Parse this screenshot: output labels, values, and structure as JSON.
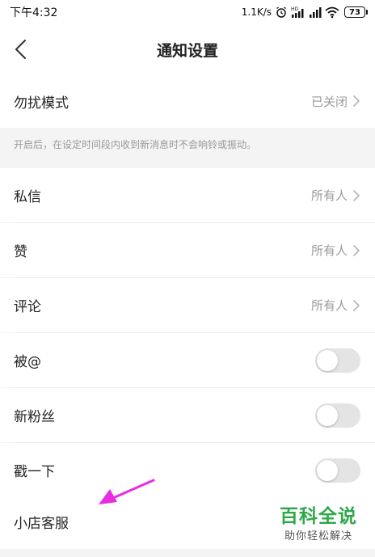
{
  "status_bar": {
    "time": "下午4:32",
    "network_speed": "1.1K/s",
    "battery_level": "73",
    "icons": [
      "alarm-icon",
      "hd-signal-icon",
      "signal-icon",
      "wifi-icon",
      "battery-icon"
    ]
  },
  "header": {
    "title": "通知设置",
    "back_icon": "chevron-left-icon"
  },
  "dnd": {
    "label": "勿扰模式",
    "value": "已关闭",
    "hint": "开启后，在设定时间段内收到新消息时不会响铃或振动。"
  },
  "settings": {
    "items": [
      {
        "label": "私信",
        "value": "所有人"
      },
      {
        "label": "赞",
        "value": "所有人"
      },
      {
        "label": "评论",
        "value": "所有人"
      },
      {
        "label": "被@",
        "enabled": false
      },
      {
        "label": "新粉丝",
        "enabled": false
      },
      {
        "label": "戳一下",
        "enabled": false
      },
      {
        "label": "小店客服"
      }
    ]
  },
  "watermark": {
    "title": "百科全说",
    "subtitle": "助你轻松解决"
  },
  "colors": {
    "background": "#f4f4f4",
    "card": "#ffffff",
    "toggle_off": "#e4e4e4",
    "annotation_arrow": "#e62ee0",
    "watermark_green": "#2fa84a"
  }
}
